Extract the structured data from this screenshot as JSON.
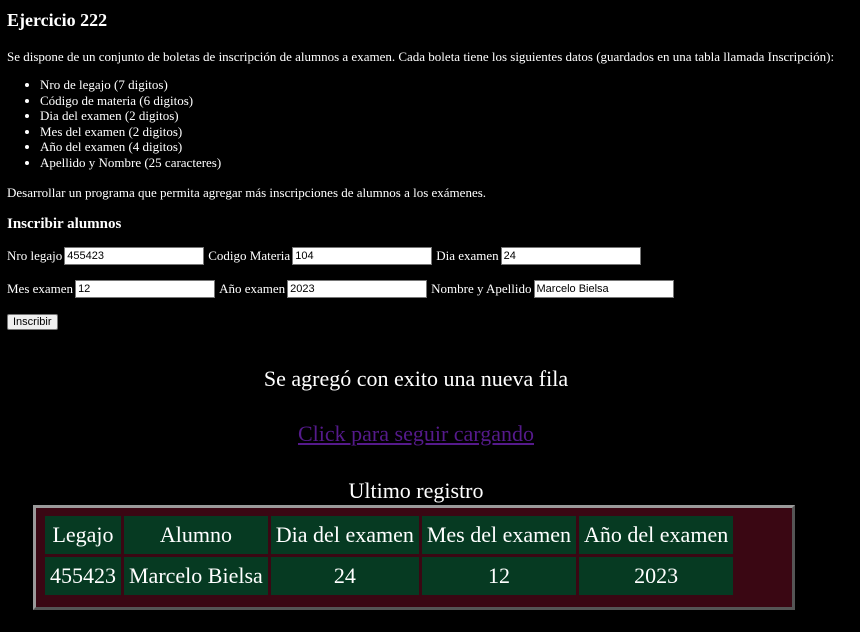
{
  "page": {
    "title": "Ejercicio 222",
    "intro": "Se dispone de un conjunto de boletas de inscripción de alumnos a examen. Cada boleta tiene los siguientes datos (guardados en una tabla llamada Inscripción):",
    "fields": [
      "Nro de legajo (7 digitos)",
      "Código de materia (6 digitos)",
      "Dia del examen (2 digitos)",
      "Mes del examen (2 digitos)",
      "Año del examen (4 digitos)",
      "Apellido y Nombre (25 caracteres)"
    ],
    "outro": "Desarrollar un programa que permita agregar más inscripciones de alumnos a los exámenes."
  },
  "form": {
    "heading": "Inscribir alumnos",
    "legajo_label": "Nro legajo",
    "legajo_value": "455423",
    "materia_label": "Codigo Materia",
    "materia_value": "104",
    "dia_label": "Dia examen",
    "dia_value": "24",
    "mes_label": "Mes examen",
    "mes_value": "12",
    "anio_label": "Año examen",
    "anio_value": "2023",
    "nombre_label": "Nombre y Apellido",
    "nombre_value": "Marcelo Bielsa",
    "submit_label": "Inscribir"
  },
  "result": {
    "success_message": "Se agregó con exito una nueva fila",
    "link_text": "Click para seguir cargando",
    "last_title": "Ultimo registro",
    "table": {
      "headers": [
        "Legajo",
        "Alumno",
        "Dia del examen",
        "Mes del examen",
        "Año del examen"
      ],
      "row": [
        "455423",
        "Marcelo Bielsa",
        "24",
        "12",
        "2023"
      ]
    }
  },
  "colors": {
    "background": "#000000",
    "cell_background": "#063a22",
    "table_background": "#3a0713",
    "link_visited": "#551a8b"
  }
}
